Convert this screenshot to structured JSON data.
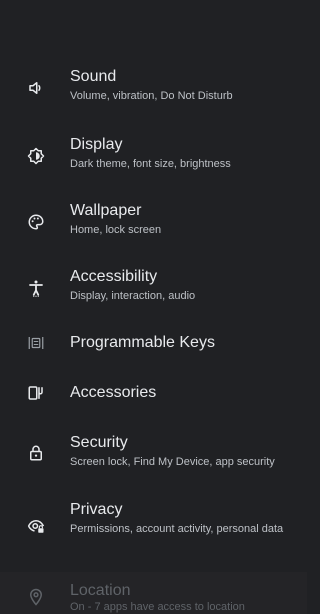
{
  "settings": {
    "items": [
      {
        "title": "Sound",
        "subtitle": "Volume, vibration, Do Not Disturb",
        "icon": "volume-icon"
      },
      {
        "title": "Display",
        "subtitle": "Dark theme, font size, brightness",
        "icon": "brightness-icon"
      },
      {
        "title": "Wallpaper",
        "subtitle": "Home, lock screen",
        "icon": "palette-icon"
      },
      {
        "title": "Accessibility",
        "subtitle": "Display, interaction, audio",
        "icon": "accessibility-icon"
      },
      {
        "title": "Programmable Keys",
        "subtitle": "",
        "icon": "programmable-keys-icon"
      },
      {
        "title": "Accessories",
        "subtitle": "",
        "icon": "accessories-icon"
      },
      {
        "title": "Security",
        "subtitle": "Screen lock, Find My Device, app security",
        "icon": "lock-icon"
      },
      {
        "title": "Privacy",
        "subtitle": "Permissions, account activity, personal data",
        "icon": "privacy-icon"
      },
      {
        "title": "Location",
        "subtitle": "On - 7 apps have access to location",
        "icon": "location-pin-icon"
      }
    ]
  },
  "colors": {
    "background": "#202124",
    "title": "#e8eaed",
    "subtitle": "#bdc1c6"
  }
}
